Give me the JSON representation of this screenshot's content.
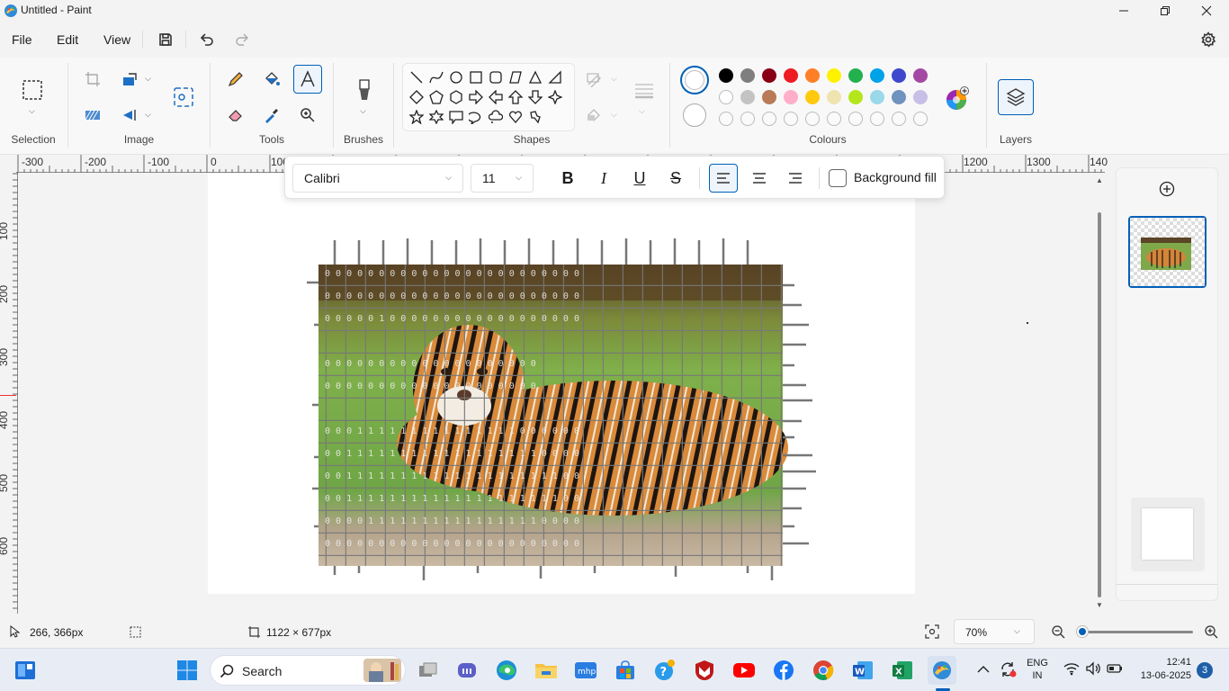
{
  "window": {
    "title": "Untitled - Paint"
  },
  "menu": {
    "items": [
      "File",
      "Edit",
      "View"
    ]
  },
  "ribbon": {
    "groups": {
      "selection": "Selection",
      "image": "Image",
      "tools": "Tools",
      "brushes": "Brushes",
      "shapes": "Shapes",
      "colours": "Colours",
      "layers": "Layers"
    },
    "palette_row1": [
      "#000000",
      "#7f7f7f",
      "#880015",
      "#ed1c24",
      "#ff7f27",
      "#fff200",
      "#22b14c",
      "#00a2e8",
      "#3f48cc",
      "#a349a4"
    ],
    "palette_row2": [
      "#ffffff",
      "#c3c3c3",
      "#b97a57",
      "#ffaec9",
      "#ffc90e",
      "#efe4b0",
      "#b5e61d",
      "#99d9ea",
      "#7092be",
      "#c8bfe7"
    ]
  },
  "text_toolbar": {
    "font": "Calibri",
    "size": "11",
    "bold": "B",
    "italic": "I",
    "underline": "U",
    "strike": "S",
    "background_fill": "Background fill"
  },
  "rulers": {
    "horizontal_labels": [
      "-300",
      "-200",
      "-100",
      "0",
      "100",
      "1200",
      "1300",
      "140"
    ],
    "vertical_labels": [
      "100",
      "200",
      "300",
      "400",
      "500",
      "600"
    ]
  },
  "status": {
    "cursor_pos": "266, 366px",
    "canvas_size": "1122 × 677px",
    "zoom": "70%",
    "zoom_level": 0.05
  },
  "taskbar": {
    "search": "Search",
    "language_top": "ENG",
    "language_bottom": "IN",
    "time": "12:41",
    "date": "13-06-2025",
    "notifications": "3"
  },
  "colors": {
    "accent": "#005fb8"
  }
}
